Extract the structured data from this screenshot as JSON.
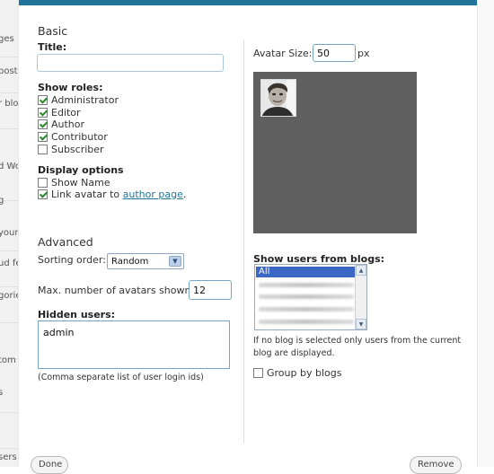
{
  "sidebar": {
    "items": [
      {
        "label": "ges"
      },
      {
        "label": "posts"
      },
      {
        "label": "r blog"
      },
      {
        "label": ""
      },
      {
        "label": "d Wo"
      },
      {
        "label": "g"
      },
      {
        "label": "your"
      },
      {
        "label": "ud fe"
      },
      {
        "label": "gorie"
      },
      {
        "label": ""
      },
      {
        "label": "tom"
      },
      {
        "label": "s"
      },
      {
        "label": ""
      },
      {
        "label": "sers"
      }
    ]
  },
  "basic": {
    "section_title": "Basic",
    "title_label": "Title:",
    "title_value": "",
    "show_roles_label": "Show roles:",
    "roles": [
      {
        "label": "Administrator",
        "checked": true
      },
      {
        "label": "Editor",
        "checked": true
      },
      {
        "label": "Author",
        "checked": true
      },
      {
        "label": "Contributor",
        "checked": true
      },
      {
        "label": "Subscriber",
        "checked": false
      }
    ],
    "display_options_label": "Display options",
    "show_name_label": "Show Name",
    "show_name_checked": false,
    "link_avatar_prefix": "Link avatar to",
    "link_avatar_link": "author page",
    "link_avatar_suffix": ".",
    "link_avatar_checked": true
  },
  "avatar": {
    "size_label": "Avatar Size:",
    "size_value": "50",
    "size_unit": "px",
    "preview_bg": "#5f5f5f"
  },
  "advanced": {
    "section_title": "Advanced",
    "sorting_label": "Sorting order:",
    "sorting_value": "Random",
    "max_label": "Max. number of avatars shown:",
    "max_value": "12",
    "hidden_users_label": "Hidden users:",
    "hidden_users_value": "admin",
    "hidden_users_note": "(Comma separate list of user login ids)"
  },
  "blogs": {
    "label": "Show users from blogs:",
    "items": [
      "All"
    ],
    "note_line1": "If no blog is selected only users from the current",
    "note_line2": "blog are displayed.",
    "group_label": "Group by blogs",
    "group_checked": false
  },
  "footer": {
    "done_label": "Done",
    "remove_label": "Remove"
  },
  "colors": {
    "accent": "#21759b",
    "selected_blog": "#3a66c4"
  }
}
